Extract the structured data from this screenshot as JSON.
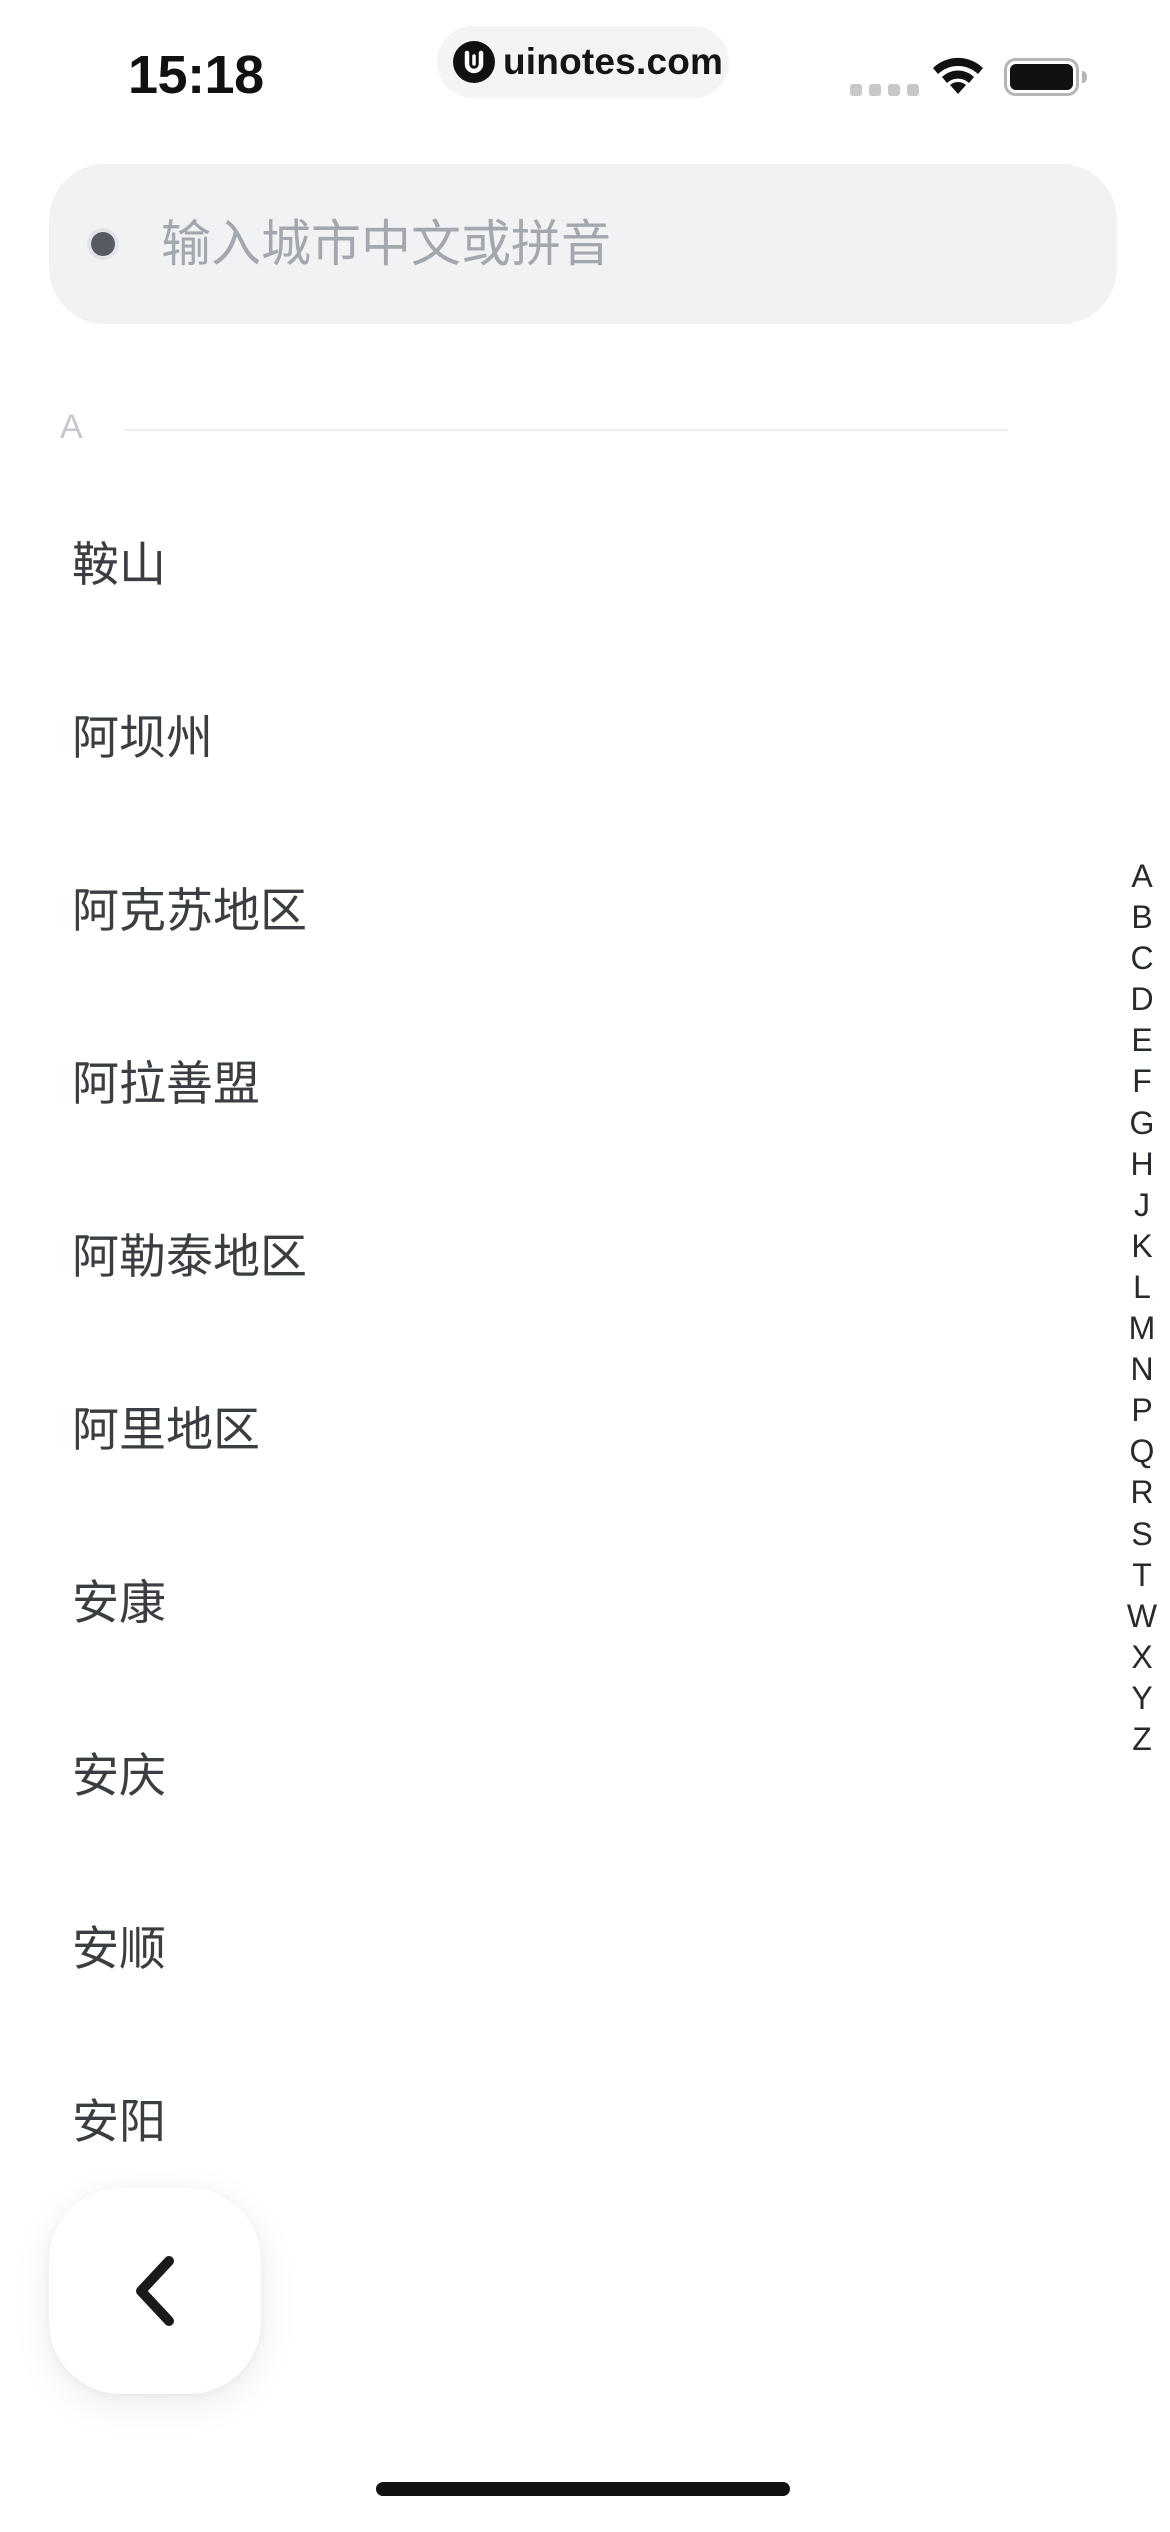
{
  "status_bar": {
    "time": "15:18",
    "watermark": "uinotes.com"
  },
  "search": {
    "placeholder": "输入城市中文或拼音",
    "value": ""
  },
  "section": {
    "letter": "A"
  },
  "cities": [
    "鞍山",
    "阿坝州",
    "阿克苏地区",
    "阿拉善盟",
    "阿勒泰地区",
    "阿里地区",
    "安康",
    "安庆",
    "安顺",
    "安阳"
  ],
  "alphabet_index": [
    "A",
    "B",
    "C",
    "D",
    "E",
    "F",
    "G",
    "H",
    "J",
    "K",
    "L",
    "M",
    "N",
    "P",
    "Q",
    "R",
    "S",
    "T",
    "W",
    "X",
    "Y",
    "Z"
  ],
  "back_button": {
    "icon": "chevron-left-icon"
  },
  "colors": {
    "search_background": "#f1f2f4",
    "text_primary": "#3a3d42",
    "placeholder": "#a3a7ae",
    "section_header": "#c3c7ce"
  }
}
